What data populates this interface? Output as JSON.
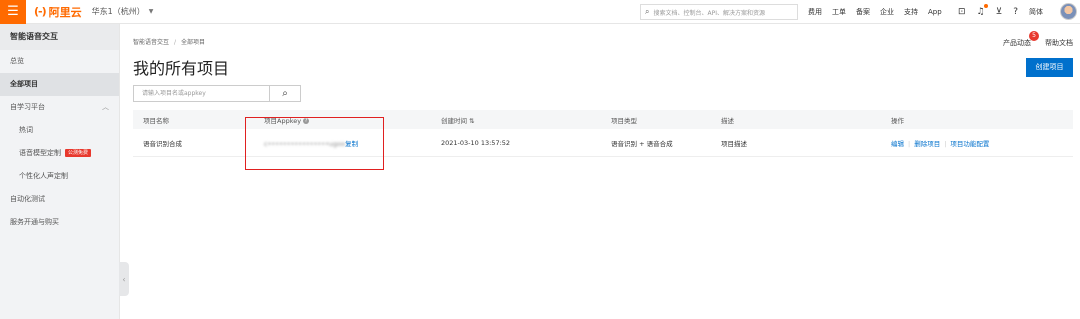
{
  "topbar": {
    "menu_icon": "hamburger-icon",
    "logo_mark": "(-)",
    "logo_text": "阿里云",
    "region": "华东1（杭州）",
    "search_placeholder": "搜索文档、控制台、API、解决方案和资源",
    "links": [
      "费用",
      "工单",
      "备案",
      "企业",
      "支持",
      "App"
    ],
    "icons": [
      "terminal-icon",
      "bell-icon",
      "cart-icon",
      "help-icon"
    ],
    "lang": "简体"
  },
  "sidebar": {
    "title": "智能语音交互",
    "items": [
      {
        "label": "总览"
      },
      {
        "label": "全部项目",
        "active": true
      },
      {
        "label": "自学习平台",
        "expandable": true
      },
      {
        "label": "热词",
        "sub": true
      },
      {
        "label": "语音模型定制",
        "sub": true,
        "badge": "公测免费"
      },
      {
        "label": "个性化人声定制",
        "sub": true
      },
      {
        "label": "自动化测试"
      },
      {
        "label": "服务开通与购买"
      }
    ]
  },
  "main": {
    "breadcrumb": [
      "智能语音交互",
      "全部项目"
    ],
    "title": "我的所有项目",
    "product_news": "产品动态",
    "product_news_count": "5",
    "help_docs": "帮助文档",
    "create_button": "创建项目",
    "filter_placeholder": "请输入项目名或appkey",
    "table": {
      "headers": [
        "项目名称",
        "项目Appkey",
        "创建时间",
        "项目类型",
        "描述",
        "操作"
      ],
      "rows": [
        {
          "name": "语音识别合成",
          "appkey": "c••••••••••••••••ugoo",
          "copy": "复制",
          "created": "2021-03-10 13:57:52",
          "type": "语音识别 + 语音合成",
          "desc": "项目描述",
          "actions": [
            "编辑",
            "删除项目",
            "项目功能配置"
          ]
        }
      ]
    }
  },
  "colors": {
    "brand": "#ff6a00",
    "primary": "#0070cc",
    "highlight": "#e02020"
  }
}
